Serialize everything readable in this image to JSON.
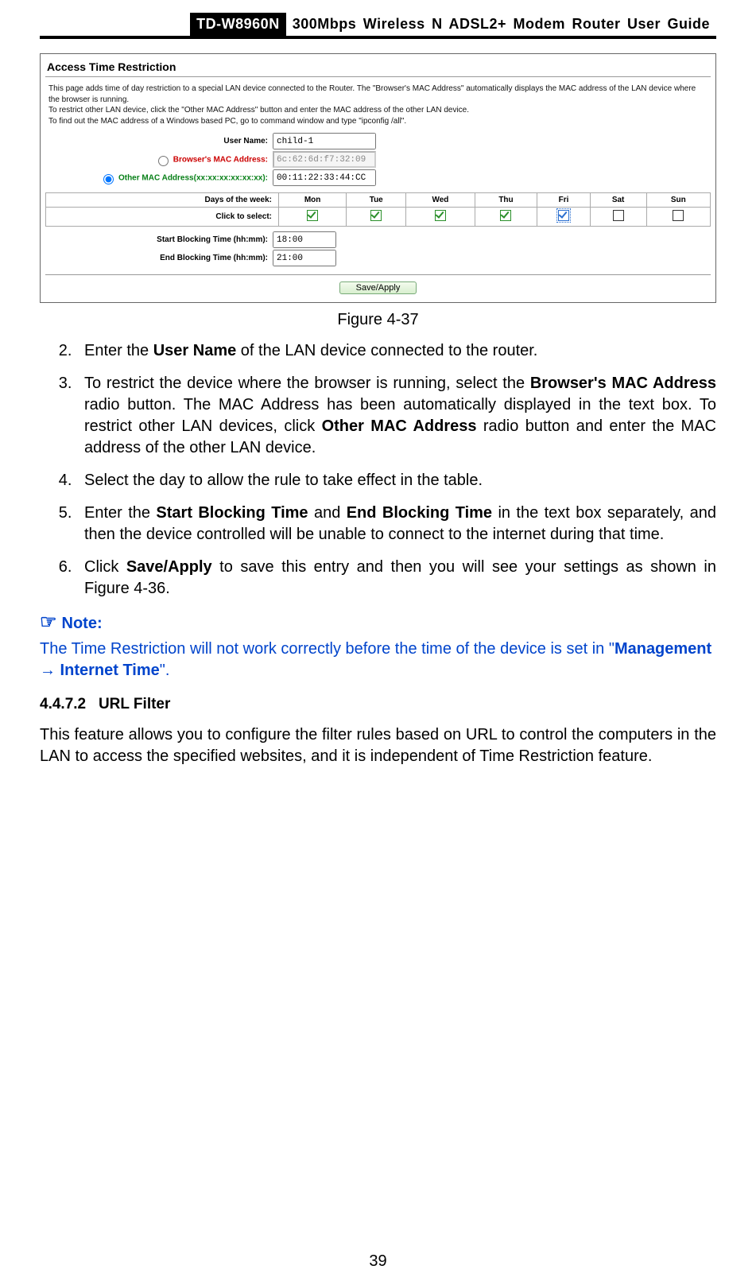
{
  "header": {
    "model": "TD-W8960N",
    "title": "300Mbps Wireless N ADSL2+ Modem Router User Guide"
  },
  "shot": {
    "title": "Access Time Restriction",
    "desc_line1": "This page adds time of day restriction to a special LAN device connected to the Router. The \"Browser's MAC Address\" automatically displays the MAC address of the LAN device where the browser is running.",
    "desc_line2": "To restrict other LAN device, click the \"Other MAC Address\" button and enter the MAC address of the other LAN device.",
    "desc_line3": "To find out the MAC address of a Windows based PC, go to command window and type \"ipconfig /all\".",
    "username_label": "User Name:",
    "username_value": "child-1",
    "browser_mac_label": "Browser's MAC Address:",
    "browser_mac_value": "6c:62:6d:f7:32:09",
    "other_mac_label": "Other MAC Address(xx:xx:xx:xx:xx:xx):",
    "other_mac_value": "00:11:22:33:44:CC",
    "days_label": "Days of the week:",
    "click_label": "Click to select:",
    "days": [
      "Mon",
      "Tue",
      "Wed",
      "Thu",
      "Fri",
      "Sat",
      "Sun"
    ],
    "checks": [
      true,
      true,
      true,
      true,
      true,
      false,
      false
    ],
    "start_label": "Start Blocking Time (hh:mm):",
    "start_value": "18:00",
    "end_label": "End Blocking Time (hh:mm):",
    "end_value": "21:00",
    "save_label": "Save/Apply"
  },
  "caption": "Figure 4-37",
  "steps": {
    "s2_a": "Enter the ",
    "s2_b": "User Name",
    "s2_c": " of the LAN device connected to the router.",
    "s3_a": "To restrict the device where the browser is running, select the ",
    "s3_b": "Browser's MAC Address",
    "s3_c": " radio button. The MAC Address has been automatically displayed in the text box. To restrict other LAN devices, click ",
    "s3_d": "Other MAC Address",
    "s3_e": " radio button and enter the MAC address of the other LAN device.",
    "s4": "Select the day to allow the rule to take effect in the table.",
    "s5_a": "Enter the ",
    "s5_b": "Start Blocking Time",
    "s5_c": " and ",
    "s5_d": "End Blocking Time",
    "s5_e": " in the text box separately, and then the device controlled will be unable to connect to the internet during that time.",
    "s6_a": "Click ",
    "s6_b": "Save/Apply",
    "s6_c": " to save this entry and then you will see your settings as shown in Figure 4-36."
  },
  "note": {
    "head": "Note:",
    "body_a": "The Time Restriction will not work correctly before the time of the device is set in \"",
    "body_b": "Management ",
    "body_arrow": "→",
    "body_c": " Internet Time",
    "body_d": "\"."
  },
  "section": {
    "num": "4.4.7.2",
    "title": "URL Filter",
    "body": "This feature allows you to configure the filter rules based on URL to control the computers in the LAN to access the specified websites, and it is independent of Time Restriction feature."
  },
  "page_number": "39"
}
